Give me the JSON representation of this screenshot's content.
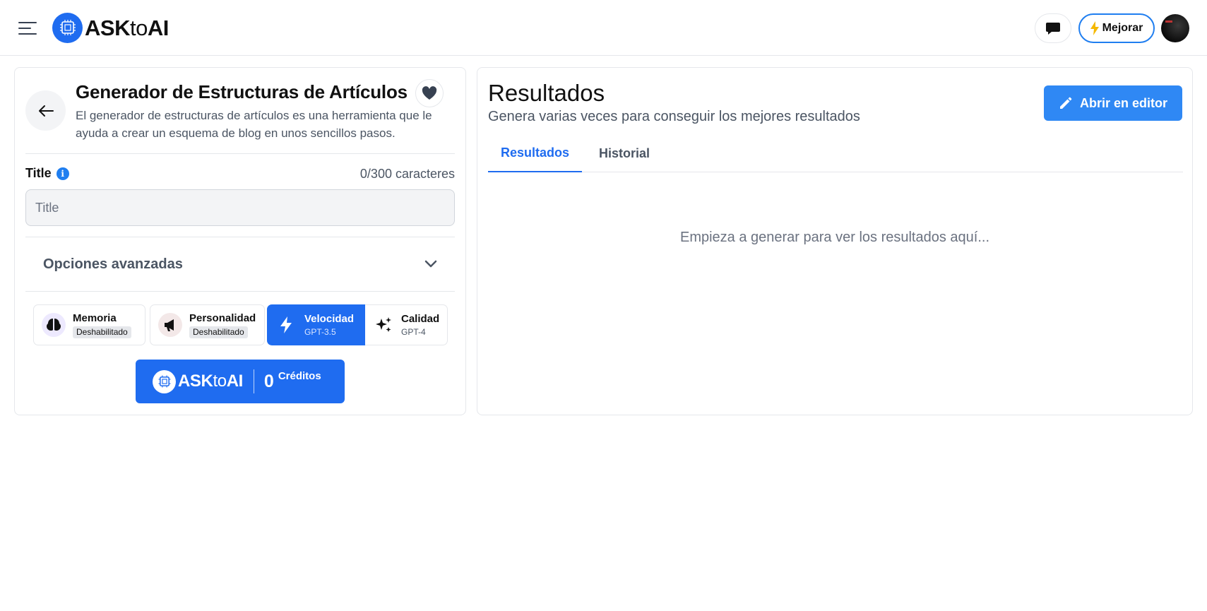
{
  "header": {
    "logo": {
      "prefix": "ASK",
      "middle": "to",
      "suffix": "AI"
    },
    "upgrade_label": "Mejorar",
    "icons": {
      "menu": "hamburger-menu-icon",
      "chat": "chat-bubble-icon",
      "bolt": "lightning-bolt-icon"
    }
  },
  "tool": {
    "title": "Generador de Estructuras de Artículos",
    "description": "El generador de estructuras de artículos es una herramienta que le ayuda a crear un esquema de blog en unos sencillos pasos.",
    "field": {
      "label": "Title",
      "placeholder": "Title",
      "value": "",
      "char_count": "0/300 caracteres"
    },
    "advanced_label": "Opciones avanzadas",
    "options": [
      {
        "title": "Memoria",
        "badge": "Deshabilitado",
        "icon": "brain-icon"
      },
      {
        "title": "Personalidad",
        "badge": "Deshabilitado",
        "icon": "megaphone-icon"
      },
      {
        "title": "Velocidad",
        "sub": "GPT-3.5",
        "icon": "lightning-icon",
        "selected": true
      },
      {
        "title": "Calidad",
        "sub": "GPT-4",
        "icon": "sparkles-icon",
        "selected": false
      }
    ],
    "credits": {
      "logo_prefix": "ASK",
      "logo_middle": "to",
      "logo_suffix": "AI",
      "count": "0",
      "label": "Créditos"
    }
  },
  "results": {
    "title": "Resultados",
    "subtitle": "Genera varias veces para conseguir los mejores resultados",
    "editor_button": "Abrir en editor",
    "tabs": [
      {
        "label": "Resultados",
        "active": true
      },
      {
        "label": "Historial",
        "active": false
      }
    ],
    "empty_message": "Empieza a generar para ver los resultados aquí..."
  },
  "colors": {
    "accent": "#1f6cf0",
    "button_blue": "#2f88f4",
    "upgrade_border": "#1f7ef0",
    "bolt": "#f5b800"
  }
}
